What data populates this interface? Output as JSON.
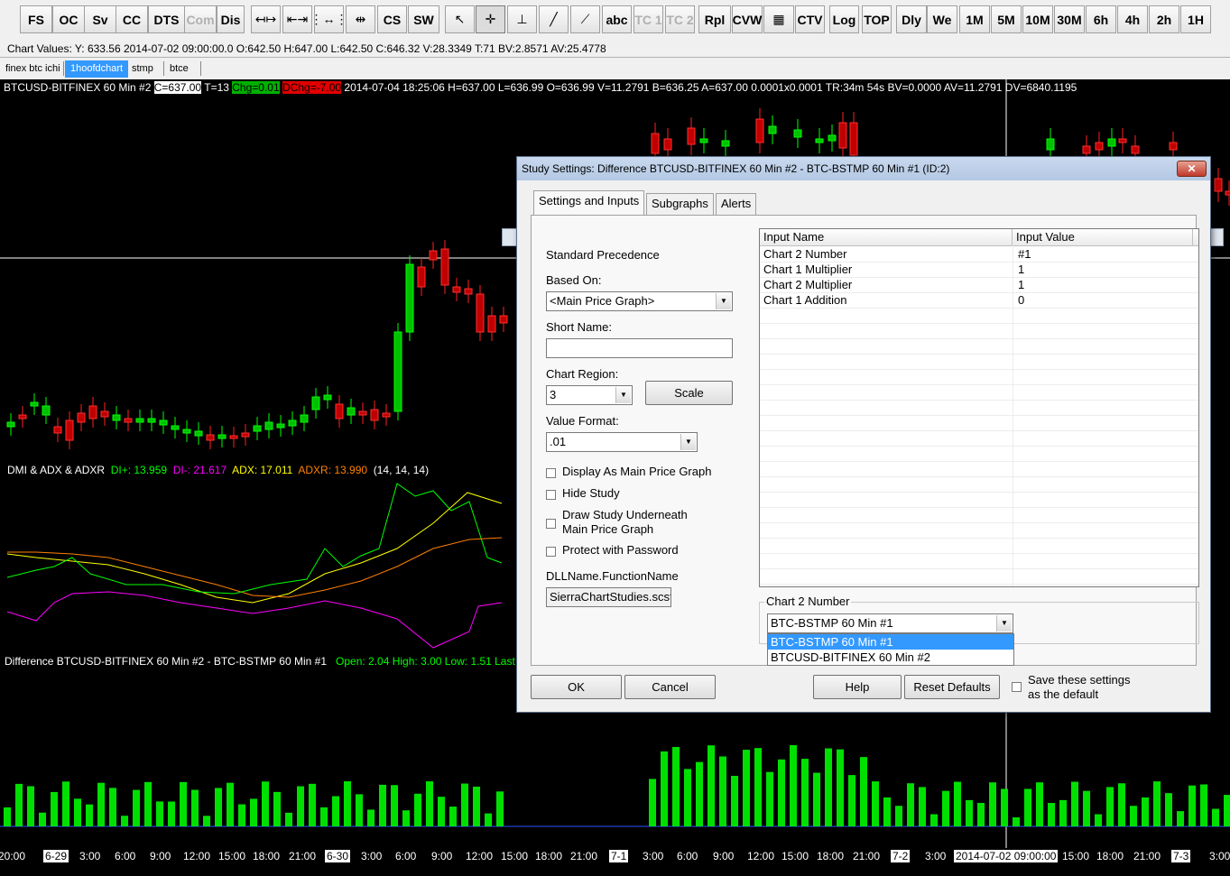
{
  "toolbar": {
    "buttons": [
      "FS",
      "OC",
      "Sv",
      "CC",
      "DTS",
      "Com",
      "Dis",
      "",
      "",
      "",
      "",
      "CS",
      "SW",
      "",
      "",
      "",
      "",
      "",
      "abc",
      "TC 1",
      "TC 2",
      "Rpl",
      "CVW",
      "",
      "CTV",
      "Log",
      "TOP",
      "Dly",
      "We",
      "1M",
      "5M",
      "10M",
      "30M",
      "6h",
      "4h",
      "2h",
      "1H"
    ]
  },
  "infobar": {
    "text": "Chart Values: Y: 633.56  2014-07-02  09:00:00.0  O:642.50  H:647.00  L:642.50  C:646.32  V:28.3349  T:71  BV:2.8571  AV:25.4778"
  },
  "tabs": [
    "finex btc ichi",
    "1hoofdchart",
    "stmp",
    "btce"
  ],
  "chart": {
    "header_prefix": "BTCUSD-BITFINEX  60 Min   #2",
    "header_c": "C=637.00",
    "header_t": "T=13",
    "header_chg": "Chg=0.01",
    "header_dchg": "DChg=-7.00",
    "header_rest": "2014-07-04  18:25:06  H=637.00  L=636.99  O=636.99  V=11.2791  B=636.25  A=637.00  0.0001x0.0001  TR:34m 54s  BV=0.0000  AV=11.2791  DV=6840.1195",
    "dmi_name": "DMI & ADX & ADXR",
    "dmi_plus": "DI+: 13.959",
    "dmi_minus": "DI-: 21.617",
    "adx": "ADX: 17.011",
    "adxr": "ADXR: 13.990",
    "dmi_params": "(14, 14, 14)",
    "diff_name": "Difference BTCUSD-BITFINEX  60 Min   #2 - BTC-BSTMP  60 Min   #1",
    "diff_vals": "Open: 2.04   High: 3.00   Low: 1.51   Last:",
    "time_labels": [
      "20:00",
      "6-29",
      "3:00",
      "6:00",
      "9:00",
      "12:00",
      "15:00",
      "18:00",
      "21:00",
      "6-30",
      "3:00",
      "6:00",
      "9:00",
      "12:00",
      "15:00",
      "18:00",
      "21:00",
      "7-1",
      "3:00",
      "6:00",
      "9:00",
      "12:00",
      "15:00",
      "18:00",
      "21:00",
      "7-2",
      "3:00",
      "2014-07-02  09:00:00",
      "15:00",
      "18:00",
      "21:00",
      "7-3",
      "3:00"
    ]
  },
  "dialog": {
    "title": "Study Settings: Difference BTCUSD-BITFINEX  60 Min   #2 - BTC-BSTMP  60 Min   #1  (ID:2)",
    "close_label": "✕",
    "tabs": [
      "Settings and Inputs",
      "Subgraphs",
      "Alerts"
    ],
    "standard_precedence": "Standard Precedence",
    "based_on_label": "Based On:",
    "based_on_value": "<Main Price Graph>",
    "short_name_label": "Short Name:",
    "short_name_value": "",
    "chart_region_label": "Chart Region:",
    "chart_region_value": "3",
    "scale_button": "Scale",
    "value_format_label": "Value Format:",
    "value_format_value": ".01",
    "checkboxes": [
      "Display As Main Price Graph",
      "Hide Study",
      "Draw Study Underneath\nMain Price Graph",
      "Protect with Password"
    ],
    "dll_label": "DLLName.FunctionName",
    "dll_value": "SierraChartStudies.scsf_",
    "grid": {
      "col_name": "Input Name",
      "col_value": "Input Value",
      "rows": [
        {
          "name": "Chart 2 Number",
          "value": "#1"
        },
        {
          "name": "Chart 1 Multiplier",
          "value": "1"
        },
        {
          "name": "Chart 2 Multiplier",
          "value": "1"
        },
        {
          "name": "Chart 1 Addition",
          "value": "0"
        }
      ]
    },
    "input_group_label": "Chart 2 Number",
    "input_combo_value": "BTC-BSTMP  60 Min  #1",
    "dropdown_options": [
      "BTC-BSTMP  60 Min  #1",
      "BTCUSD-BITFINEX  60 Min  #2"
    ],
    "ok": "OK",
    "cancel": "Cancel",
    "help": "Help",
    "reset": "Reset Defaults",
    "save_default": "Save these settings\nas the default"
  }
}
